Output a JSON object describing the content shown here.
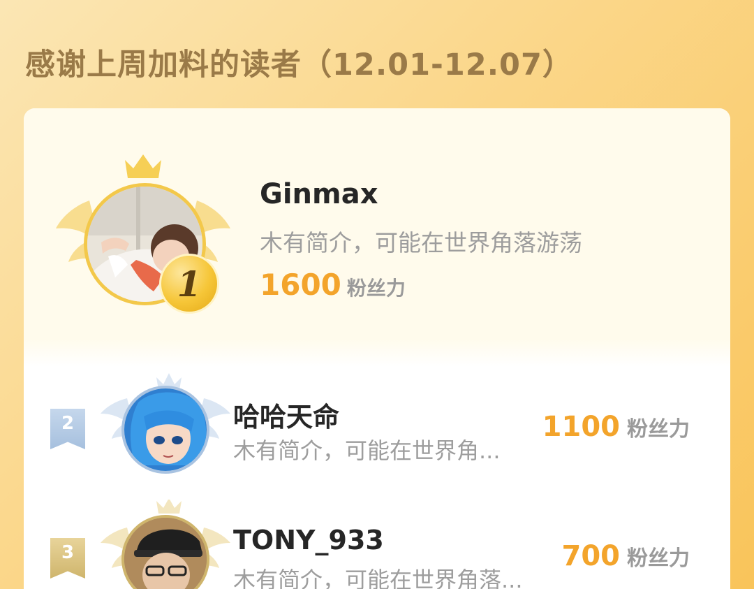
{
  "header": {
    "title": "感谢上周加料的读者（12.01-12.07）"
  },
  "top_reader": {
    "rank": "1",
    "name": "Ginmax",
    "bio": "木有简介，可能在世界角落游荡",
    "score": "1600",
    "unit": "粉丝力"
  },
  "readers": [
    {
      "rank": "2",
      "name": "哈哈天命",
      "bio": "木有简介，可能在世界角...",
      "score": "1100",
      "unit": "粉丝力"
    },
    {
      "rank": "3",
      "name": "TONY_933",
      "bio": "木有简介，可能在世界角落...",
      "score": "700",
      "unit": "粉丝力"
    }
  ],
  "colors": {
    "accent_number": "#f3a42b",
    "title": "#9a7a48",
    "gold": "#f3c84a",
    "silver": "#a6c0de",
    "bronze": "#cfb56c"
  },
  "icons": {
    "top_crown": "crown-icon",
    "top_wings": "wings-icon",
    "rank_medal": "medal-icon",
    "rank_badge": "ribbon-badge-icon"
  }
}
